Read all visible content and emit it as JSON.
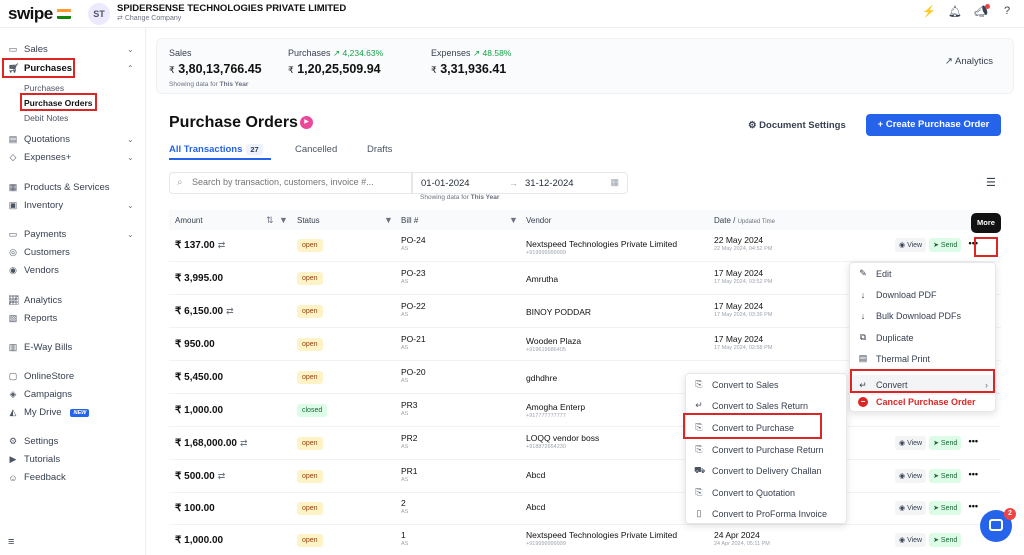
{
  "topbar": {
    "logo": "swipe",
    "flag_colors": [
      "#ff9933",
      "#ffffff",
      "#138808"
    ],
    "avatar_initials": "ST",
    "company_name": "SPIDERSENSE TECHNOLOGIES PRIVATE LIMITED",
    "change_company": "Change Company",
    "icons": [
      "bolt-icon",
      "bell-icon",
      "megaphone-icon",
      "help-icon"
    ]
  },
  "sidebar": {
    "sales": "Sales",
    "purchases": "Purchases",
    "purchases_sub": [
      "Purchases",
      "Purchase Orders",
      "Debit Notes"
    ],
    "quotations": "Quotations",
    "expenses": "Expenses+",
    "products": "Products & Services",
    "inventory": "Inventory",
    "payments": "Payments",
    "customers": "Customers",
    "vendors": "Vendors",
    "analytics": "Analytics",
    "reports": "Reports",
    "eway": "E-Way Bills",
    "onlinestore": "OnlineStore",
    "campaigns": "Campaigns",
    "mydrive": "My Drive",
    "new_badge": "NEW",
    "settings": "Settings",
    "tutorials": "Tutorials",
    "feedback": "Feedback"
  },
  "stats": {
    "sales_label": "Sales",
    "sales_value": "3,80,13,766.45",
    "purchases_label": "Purchases",
    "purchases_pct": "4,234.63%",
    "purchases_value": "1,20,25,509.94",
    "expenses_label": "Expenses",
    "expenses_pct": "48.58%",
    "expenses_value": "3,31,936.41",
    "currency": "₹",
    "note_prefix": "Showing data for",
    "note_period": "This Year",
    "analytics": "Analytics"
  },
  "page": {
    "title": "Purchase Orders",
    "document_settings": "Document Settings",
    "create_button": "Create Purchase Order",
    "tabs": {
      "all": "All Transactions",
      "all_count": "27",
      "cancelled": "Cancelled",
      "drafts": "Drafts"
    },
    "search_placeholder": "Search by transaction, customers, invoice #...",
    "date_from": "01-01-2024",
    "date_to": "31-12-2024",
    "date_note_prefix": "Showing data for",
    "date_note_period": "This Year"
  },
  "table": {
    "headers": {
      "amount": "Amount",
      "status": "Status",
      "bill": "Bill #",
      "vendor": "Vendor",
      "date": "Date",
      "updated": "Updated Time"
    },
    "view_label": "View",
    "send_label": "Send",
    "rows": [
      {
        "amount": "137.00",
        "recurring": true,
        "status": "open",
        "bill": "PO-24",
        "bill_sub": "AS",
        "vendor": "Nextspeed Technologies Private Limited",
        "vendor_sub": "+919999999999",
        "date": "22 May 2024",
        "date_sub": "22 May 2024, 04:52 PM"
      },
      {
        "amount": "3,995.00",
        "recurring": false,
        "status": "open",
        "bill": "PO-23",
        "bill_sub": "AS",
        "vendor": "Amrutha",
        "vendor_sub": "",
        "date": "17 May 2024",
        "date_sub": "17 May 2024, 03:52 PM"
      },
      {
        "amount": "6,150.00",
        "recurring": true,
        "status": "open",
        "bill": "PO-22",
        "bill_sub": "AS",
        "vendor": "BINOY PODDAR",
        "vendor_sub": "",
        "date": "17 May 2024",
        "date_sub": "17 May 2024, 03:36 PM"
      },
      {
        "amount": "950.00",
        "recurring": false,
        "status": "open",
        "bill": "PO-21",
        "bill_sub": "AS",
        "vendor": "Wooden Plaza",
        "vendor_sub": "+919619686405",
        "date": "17 May 2024",
        "date_sub": "17 May 2024, 02:58 PM"
      },
      {
        "amount": "5,450.00",
        "recurring": false,
        "status": "open",
        "bill": "PO-20",
        "bill_sub": "AS",
        "vendor": "gdhdhre",
        "vendor_sub": "",
        "date": "",
        "date_sub": ""
      },
      {
        "amount": "1,000.00",
        "recurring": false,
        "status": "closed",
        "bill": "PR3",
        "bill_sub": "AS",
        "vendor": "Amogha Enterp",
        "vendor_sub": "+917777777777",
        "date": "",
        "date_sub": ""
      },
      {
        "amount": "1,68,000.00",
        "recurring": true,
        "status": "open",
        "bill": "PR2",
        "bill_sub": "AS",
        "vendor": "LOQQ vendor boss",
        "vendor_sub": "+918872654230",
        "date": "",
        "date_sub": ""
      },
      {
        "amount": "500.00",
        "recurring": true,
        "status": "open",
        "bill": "PR1",
        "bill_sub": "AS",
        "vendor": "Abcd",
        "vendor_sub": "",
        "date": "",
        "date_sub": ""
      },
      {
        "amount": "100.00",
        "recurring": false,
        "status": "open",
        "bill": "2",
        "bill_sub": "AS",
        "vendor": "Abcd",
        "vendor_sub": "",
        "date": "",
        "date_sub": ""
      },
      {
        "amount": "1,000.00",
        "recurring": false,
        "status": "open",
        "bill": "1",
        "bill_sub": "AS",
        "vendor": "Nextspeed Technologies Private Limited",
        "vendor_sub": "+919999999999",
        "date": "24 Apr 2024",
        "date_sub": "24 Apr 2024, 05:11 PM"
      }
    ]
  },
  "tooltip": "More",
  "more_menu": {
    "edit": "Edit",
    "download_pdf": "Download PDF",
    "bulk_download": "Bulk Download PDFs",
    "duplicate": "Duplicate",
    "thermal_print": "Thermal Print",
    "convert": "Convert",
    "cancel": "Cancel Purchase Order"
  },
  "convert_menu": {
    "to_sales": "Convert to Sales",
    "to_sales_return": "Convert to Sales Return",
    "to_purchase": "Convert to Purchase",
    "to_purchase_return": "Convert to Purchase Return",
    "to_delivery_challan": "Convert to Delivery Challan",
    "to_quotation": "Convert to Quotation",
    "to_proforma": "Convert to ProForma Invoice"
  },
  "chat_badge": "2",
  "colors": {
    "primary": "#2563eb",
    "danger": "#dc2626",
    "success": "#16a34a",
    "open_badge": "#fef3c7",
    "closed_badge": "#dcfce7"
  }
}
